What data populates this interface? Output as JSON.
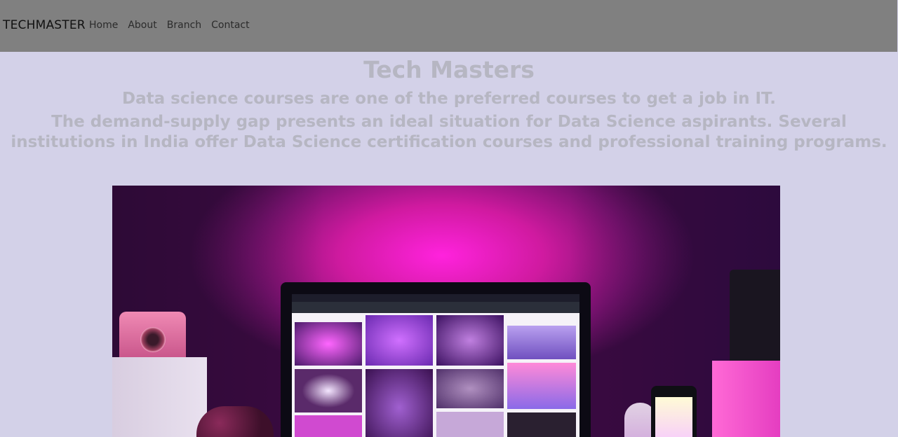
{
  "navbar": {
    "brand": "TECHMASTER",
    "links": [
      "Home",
      "About",
      "Branch",
      "Contact"
    ]
  },
  "hero": {
    "title": "Tech Masters",
    "subtitle": "Data science courses are one of the preferred courses to get a job in IT.",
    "description": "The demand-supply gap presents an ideal situation for Data Science aspirants. Several institutions in India offer Data Science certification courses and professional training programs."
  },
  "colors": {
    "page_bg": "#d3d1e8",
    "navbar_bg": "#808080",
    "hero_text": "#b6b6c2"
  },
  "image": {
    "icon": "desk-setup-photo"
  }
}
